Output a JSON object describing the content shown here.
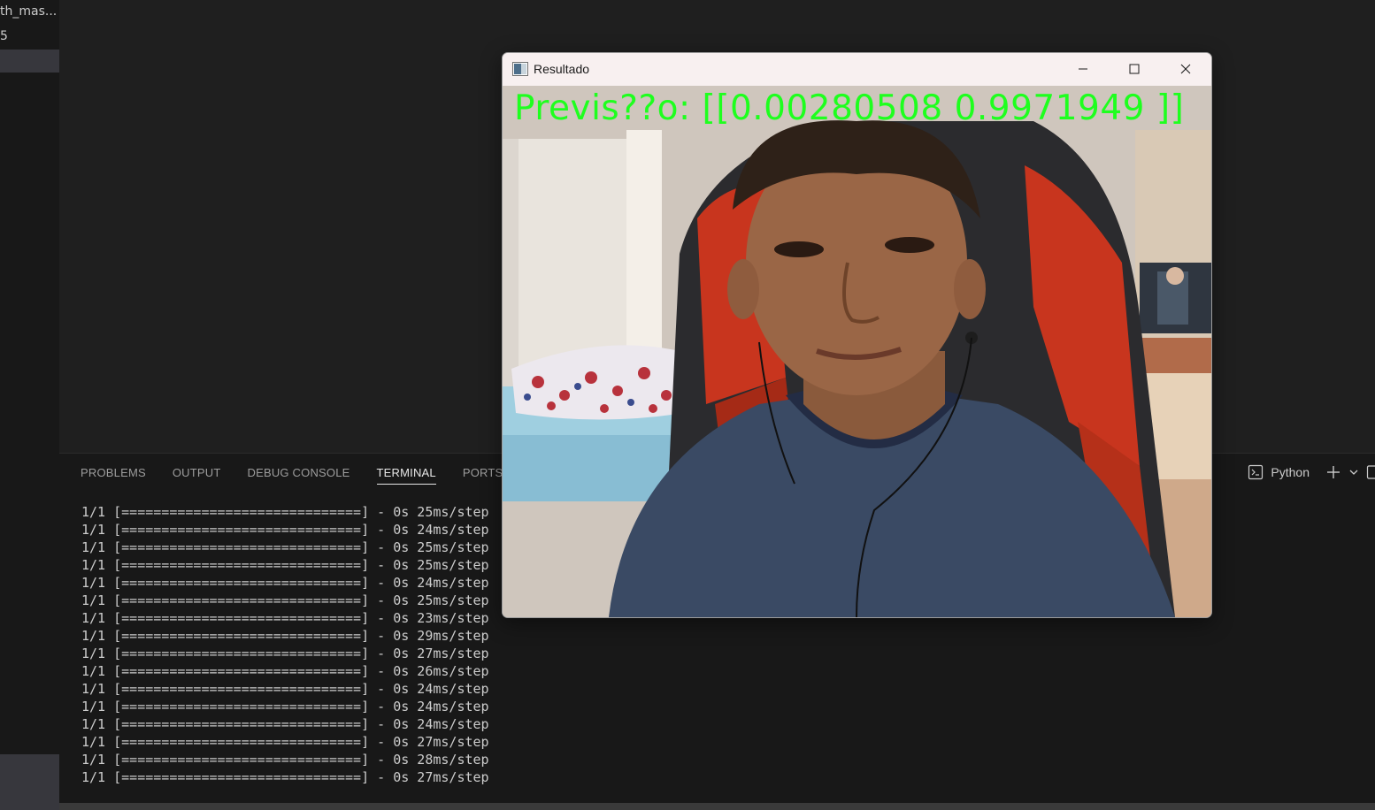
{
  "explorer": {
    "file_name": "th_mas...",
    "file_sub": "5"
  },
  "panel": {
    "tabs": [
      {
        "label": "PROBLEMS",
        "active": false
      },
      {
        "label": "OUTPUT",
        "active": false
      },
      {
        "label": "DEBUG CONSOLE",
        "active": false
      },
      {
        "label": "TERMINAL",
        "active": true
      },
      {
        "label": "PORTS",
        "active": false
      }
    ],
    "terminal_profile": "Python",
    "icons": [
      "terminal-icon",
      "plus-icon",
      "chevron-down-icon",
      "split-terminal-icon"
    ]
  },
  "terminal": {
    "lines": [
      "1/1 [==============================] - 0s 25ms/step",
      "1/1 [==============================] - 0s 24ms/step",
      "1/1 [==============================] - 0s 25ms/step",
      "1/1 [==============================] - 0s 25ms/step",
      "1/1 [==============================] - 0s 24ms/step",
      "1/1 [==============================] - 0s 25ms/step",
      "1/1 [==============================] - 0s 23ms/step",
      "1/1 [==============================] - 0s 29ms/step",
      "1/1 [==============================] - 0s 27ms/step",
      "1/1 [==============================] - 0s 26ms/step",
      "1/1 [==============================] - 0s 24ms/step",
      "1/1 [==============================] - 0s 24ms/step",
      "1/1 [==============================] - 0s 24ms/step",
      "1/1 [==============================] - 0s 27ms/step",
      "1/1 [==============================] - 0s 28ms/step",
      "1/1 [==============================] - 0s 27ms/step"
    ]
  },
  "result_window": {
    "title": "Resultado",
    "overlay_text": "Previs??o: [[0.00280508  0.9971949 ]]",
    "overlay_color": "#1eff1e",
    "controls": [
      "minimize-icon",
      "maximize-icon",
      "close-icon"
    ]
  }
}
